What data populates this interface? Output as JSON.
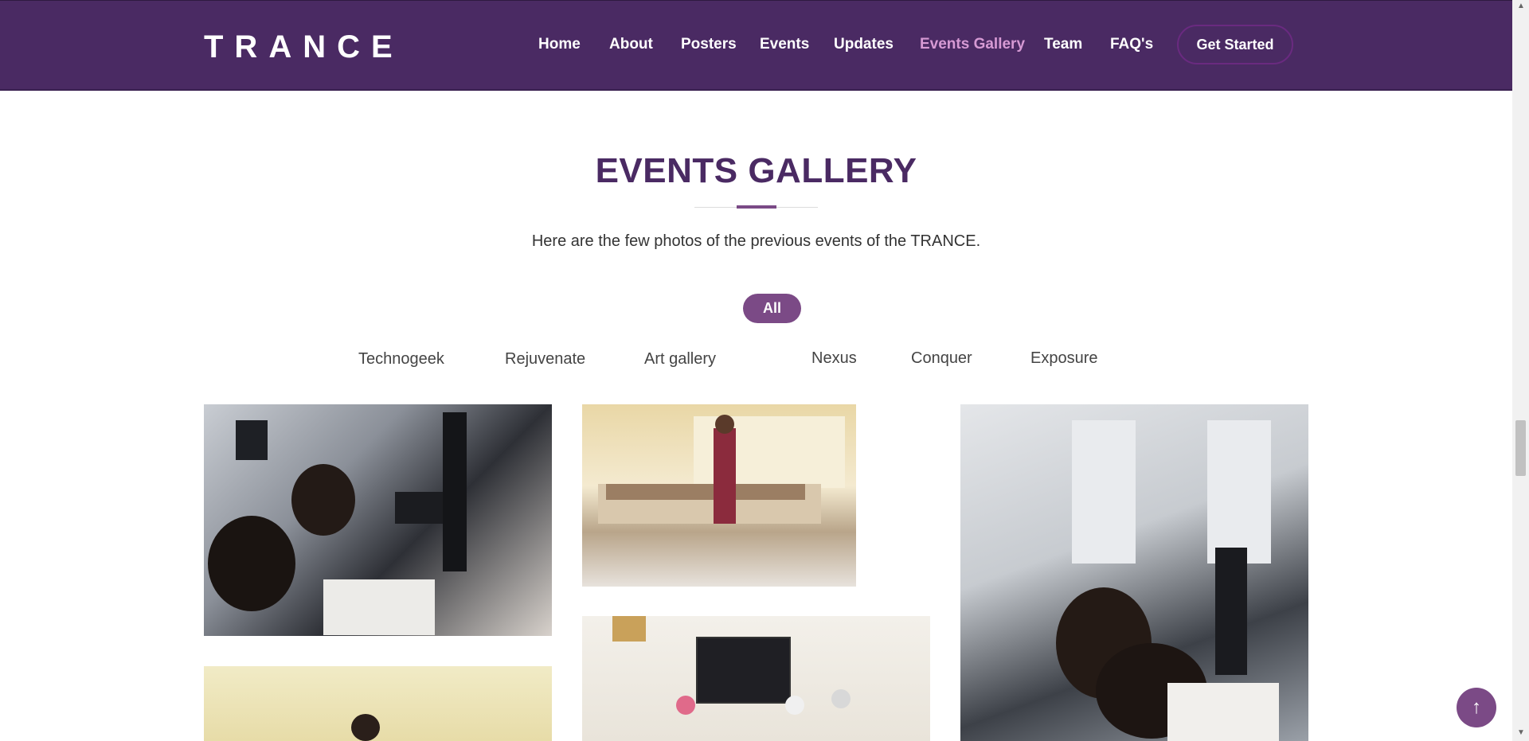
{
  "header": {
    "logo": "TRANCE",
    "nav": [
      "Home",
      "About",
      "Posters",
      "Events",
      "Updates",
      "Events Gallery",
      "Team",
      "FAQ's"
    ],
    "active_nav": "Events Gallery",
    "cta": "Get Started"
  },
  "section": {
    "title": "EVENTS GALLERY",
    "subtitle": "Here are the few photos of the previous events of the TRANCE."
  },
  "filters": {
    "active": "All",
    "items": [
      "Technogeek",
      "Rejuvenate",
      "Art gallery",
      "Nexus",
      "Conquer",
      "Exposure"
    ]
  },
  "scroll_top_icon": "arrow-up-icon",
  "colors": {
    "header_bg": "#4a2a63",
    "accent": "#7b4a86",
    "active_nav": "#d69ad4"
  }
}
